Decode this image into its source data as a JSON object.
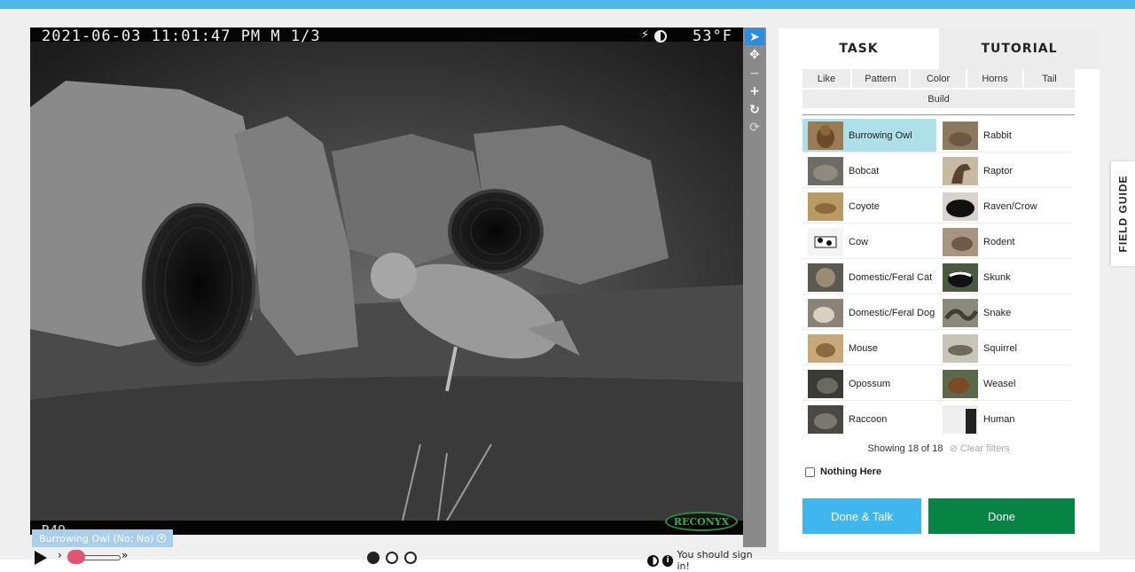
{
  "camera": {
    "timestamp": "2021-06-03 11:01:47 PM  M 1/3",
    "temperature": "53°F",
    "camera_id": "R49",
    "brand": "RECONYX"
  },
  "tools": [
    "pointer-icon",
    "move-icon",
    "zoom-out-icon",
    "zoom-in-icon",
    "rotate-icon",
    "reset-icon"
  ],
  "subject_chip": "Burrowing Owl (No; No)",
  "controls": {
    "slow_label": "›",
    "fast_label": "»",
    "frames": 3,
    "active_frame": 1,
    "signin_text": "You should sign in!"
  },
  "panel": {
    "tabs": [
      "TASK",
      "TUTORIAL"
    ],
    "filters": [
      "Like",
      "Pattern",
      "Color",
      "Horns",
      "Tail",
      "Build"
    ],
    "choices": [
      {
        "label": "Burrowing Owl",
        "selected": true
      },
      {
        "label": "Rabbit"
      },
      {
        "label": "Bobcat"
      },
      {
        "label": "Raptor"
      },
      {
        "label": "Coyote"
      },
      {
        "label": "Raven/Crow"
      },
      {
        "label": "Cow"
      },
      {
        "label": "Rodent"
      },
      {
        "label": "Domestic/Feral Cat"
      },
      {
        "label": "Skunk"
      },
      {
        "label": "Domestic/Feral Dog"
      },
      {
        "label": "Snake"
      },
      {
        "label": "Mouse"
      },
      {
        "label": "Squirrel"
      },
      {
        "label": "Opossum"
      },
      {
        "label": "Weasel"
      },
      {
        "label": "Raccoon"
      },
      {
        "label": "Human"
      }
    ],
    "showing": "Showing 18 of 18",
    "clear_filters": "Clear filters",
    "nothing_here": "Nothing Here",
    "done_talk": "Done & Talk",
    "done": "Done"
  },
  "field_guide": "FIELD GUIDE",
  "colors": {
    "accent_blue": "#3fb7ee",
    "done_green": "#078344",
    "selected_choice": "#ade0e8"
  }
}
